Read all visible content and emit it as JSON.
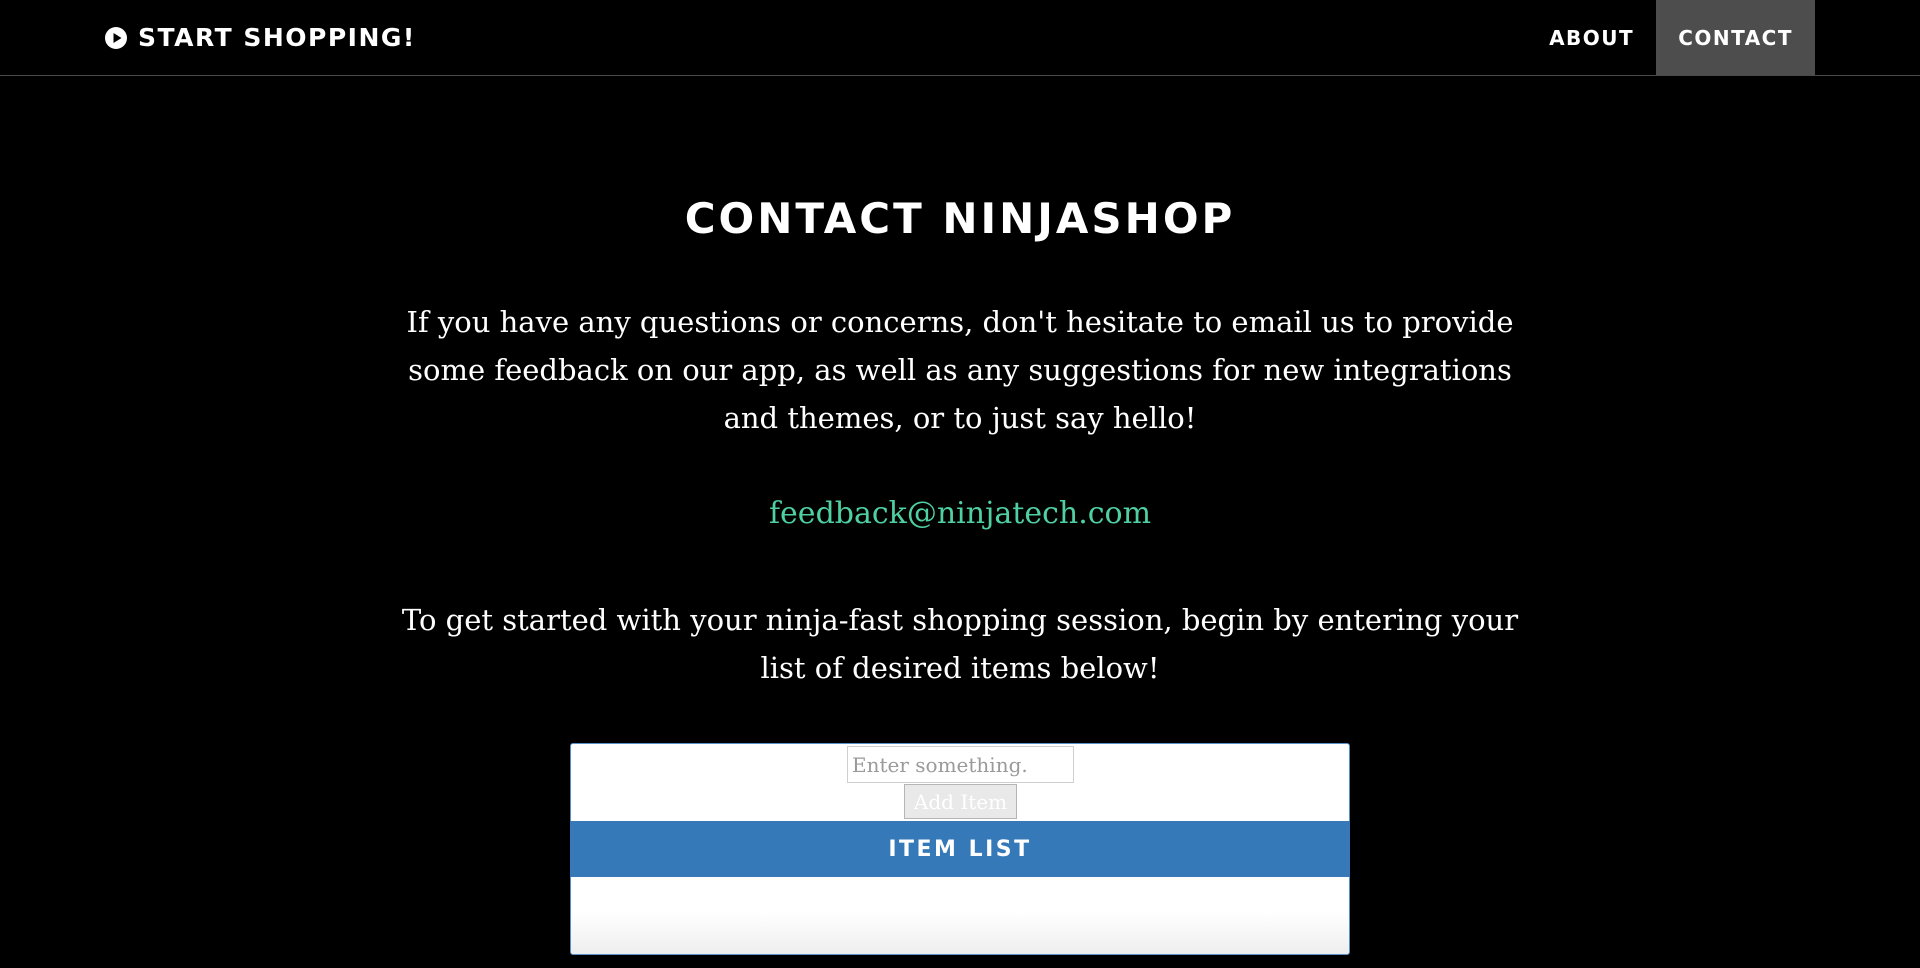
{
  "navbar": {
    "brand_label": "START SHOPPING!",
    "brand_icon": "play-circle-icon",
    "links": [
      {
        "label": "ABOUT",
        "active": false
      },
      {
        "label": "CONTACT",
        "active": true
      }
    ]
  },
  "main": {
    "title": "CONTACT NINJASHOP",
    "intro": "If you have any questions or concerns, don't hesitate to email us to provide some feedback on our app, as well as any suggestions for new integrations and themes, or to just say hello!",
    "email": "feedback@ninjatech.com",
    "get_started": "To get started with your ninja-fast shopping session, begin by entering your list of desired items below!"
  },
  "item_widget": {
    "input_value": "",
    "input_placeholder": "Enter something.",
    "add_button_label": "Add Item",
    "list_header": "ITEM LIST",
    "items": []
  },
  "colors": {
    "background": "#000000",
    "nav_active": "#4d4d4d",
    "email_link": "#4fd0a2",
    "list_header": "#3579b8"
  }
}
